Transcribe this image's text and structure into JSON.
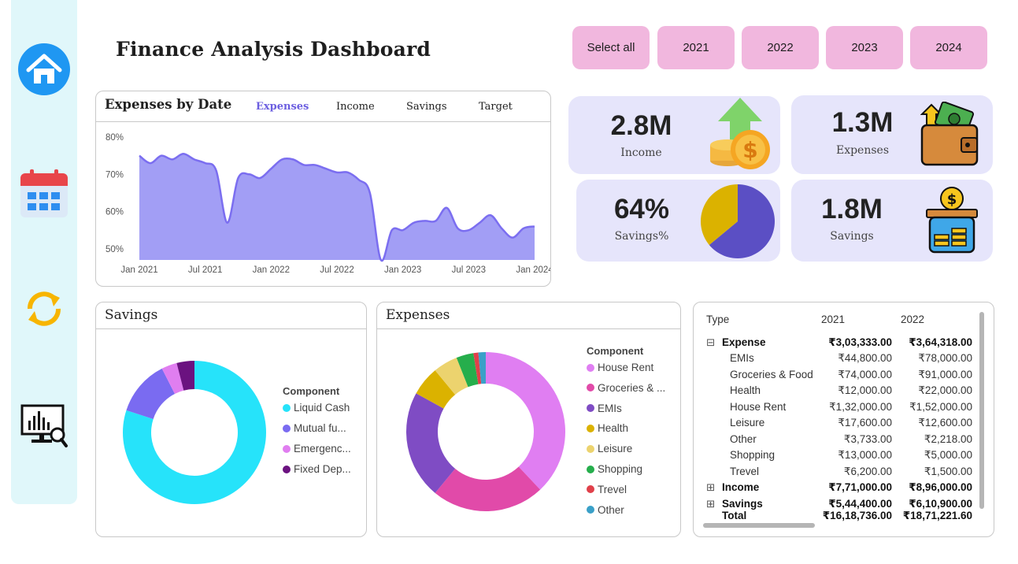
{
  "header": {
    "title": "Finance Analysis Dashboard"
  },
  "sidebar": {
    "items": [
      {
        "icon": "home-icon"
      },
      {
        "icon": "calendar-icon"
      },
      {
        "icon": "refresh-icon"
      },
      {
        "icon": "analytics-monitor-icon"
      }
    ]
  },
  "filters": [
    "Select all",
    "2021",
    "2022",
    "2023",
    "2024"
  ],
  "line_card": {
    "title": "Expenses by Date",
    "tabs": [
      "Expenses",
      "Income",
      "Savings",
      "Target"
    ],
    "active_tab": "Expenses"
  },
  "kpis": {
    "income": {
      "value": "2.8M",
      "label": "Income"
    },
    "expenses": {
      "value": "1.3M",
      "label": "Expenses"
    },
    "savings_pct": {
      "value": "64%",
      "label": "Savings%"
    },
    "savings": {
      "value": "1.8M",
      "label": "Savings"
    }
  },
  "savings_card": {
    "title": "Savings",
    "legend_title": "Component",
    "legend": [
      "Liquid Cash",
      "Mutual fu...",
      "Emergenc...",
      "Fixed Dep..."
    ]
  },
  "expenses_card": {
    "title": "Expenses",
    "legend_title": "Component",
    "legend": [
      "House Rent",
      "Groceries & ...",
      "EMIs",
      "Health",
      "Leisure",
      "Shopping",
      "Trevel",
      "Other"
    ]
  },
  "matrix": {
    "headers": [
      "Type",
      "2021",
      "2022"
    ],
    "rows": [
      {
        "label": "Expense",
        "v2021": "₹3,03,333.00",
        "v2022": "₹3,64,318.00",
        "level": 0,
        "expander": "⊟"
      },
      {
        "label": "EMIs",
        "v2021": "₹44,800.00",
        "v2022": "₹78,000.00",
        "level": 1
      },
      {
        "label": "Groceries & Food",
        "v2021": "₹74,000.00",
        "v2022": "₹91,000.00",
        "level": 1
      },
      {
        "label": "Health",
        "v2021": "₹12,000.00",
        "v2022": "₹22,000.00",
        "level": 1
      },
      {
        "label": "House Rent",
        "v2021": "₹1,32,000.00",
        "v2022": "₹1,52,000.00",
        "level": 1
      },
      {
        "label": "Leisure",
        "v2021": "₹17,600.00",
        "v2022": "₹12,600.00",
        "level": 1
      },
      {
        "label": "Other",
        "v2021": "₹3,733.00",
        "v2022": "₹2,218.00",
        "level": 1
      },
      {
        "label": "Shopping",
        "v2021": "₹13,000.00",
        "v2022": "₹5,000.00",
        "level": 1
      },
      {
        "label": "Trevel",
        "v2021": "₹6,200.00",
        "v2022": "₹1,500.00",
        "level": 1
      },
      {
        "label": "Income",
        "v2021": "₹7,71,000.00",
        "v2022": "₹8,96,000.00",
        "level": 0,
        "expander": "⊞"
      },
      {
        "label": "Savings",
        "v2021": "₹5,44,400.00",
        "v2022": "₹6,10,900.00",
        "level": 0,
        "expander": "⊞"
      },
      {
        "label": "Total",
        "v2021": "₹16,18,736.00",
        "v2022": "₹18,71,221.60",
        "level": 0
      }
    ]
  },
  "chart_data": [
    {
      "type": "area",
      "title": "Expenses by Date",
      "x": [
        "2021-01",
        "2021-02",
        "2021-03",
        "2021-04",
        "2021-05",
        "2021-06",
        "2021-07",
        "2021-08",
        "2021-09",
        "2021-10",
        "2021-11",
        "2021-12",
        "2022-01",
        "2022-02",
        "2022-03",
        "2022-04",
        "2022-05",
        "2022-06",
        "2022-07",
        "2022-08",
        "2022-09",
        "2022-10",
        "2022-11",
        "2022-12",
        "2023-01",
        "2023-02",
        "2023-03",
        "2023-04",
        "2023-05",
        "2023-06",
        "2023-07",
        "2023-08",
        "2023-09",
        "2023-10",
        "2023-11",
        "2023-12",
        "2024-01"
      ],
      "y": [
        75,
        73,
        75,
        74,
        75.5,
        74,
        73,
        71,
        57,
        69,
        70,
        69,
        71.5,
        74,
        74,
        72.5,
        72.5,
        71.5,
        70.5,
        70.5,
        68.5,
        65,
        47,
        55,
        55,
        57,
        57.5,
        57.5,
        61,
        55.5,
        55,
        57,
        59,
        55.5,
        53,
        55.5,
        56
      ],
      "x_ticks": [
        "Jan 2021",
        "Jul 2021",
        "Jan 2022",
        "Jul 2022",
        "Jan 2023",
        "Jul 2023",
        "Jan 2024"
      ],
      "y_ticks": [
        "50%",
        "60%",
        "70%",
        "80%"
      ],
      "ylim": [
        47,
        80
      ],
      "color": "#a29ef5",
      "line_color": "#7b6ef0"
    },
    {
      "type": "pie",
      "title": "Savings%",
      "values": [
        64,
        36
      ],
      "colors": [
        "#5b4fc4",
        "#dbb200"
      ]
    },
    {
      "type": "pie",
      "title": "Savings",
      "categories": [
        "Liquid Cash",
        "Mutual fu...",
        "Emergenc...",
        "Fixed Dep..."
      ],
      "values": [
        80,
        12.5,
        3.5,
        4
      ],
      "colors": [
        "#26e3fa",
        "#7a6bf1",
        "#e07ef0",
        "#6b1280"
      ]
    },
    {
      "type": "pie",
      "title": "Expenses",
      "categories": [
        "House Rent",
        "Groceries & ...",
        "EMIs",
        "Health",
        "Leisure",
        "Shopping",
        "Trevel",
        "Other"
      ],
      "values": [
        38,
        23,
        22,
        6,
        5,
        3.5,
        1,
        1.5
      ],
      "colors": [
        "#e07ef2",
        "#e14aa9",
        "#7f4cc4",
        "#dbb200",
        "#ecd36e",
        "#26ae4c",
        "#e0404a",
        "#3aa0c8"
      ]
    }
  ]
}
